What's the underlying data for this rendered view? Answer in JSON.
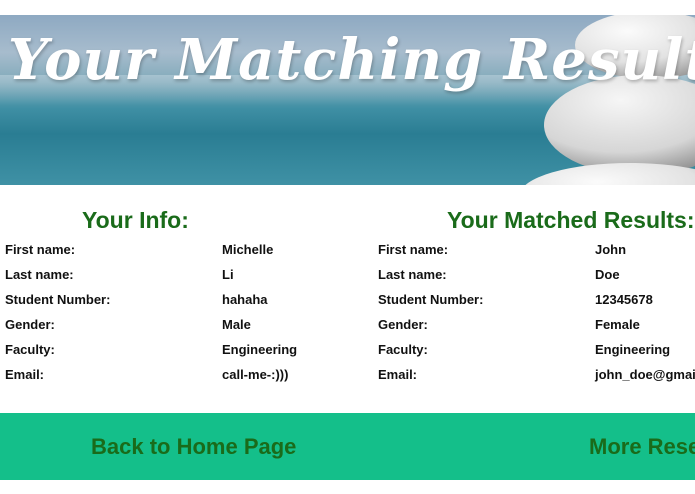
{
  "banner": {
    "title": "Your Matching Results"
  },
  "your_info": {
    "heading": "Your Info:",
    "rows": [
      {
        "label": "First name:",
        "value": "Michelle"
      },
      {
        "label": "Last name:",
        "value": "Li"
      },
      {
        "label": "Student Number:",
        "value": "hahaha"
      },
      {
        "label": "Gender:",
        "value": "Male"
      },
      {
        "label": "Faculty:",
        "value": "Engineering"
      },
      {
        "label": "Email:",
        "value": "call-me-:)))"
      }
    ]
  },
  "matched": {
    "heading": "Your Matched Results:",
    "rows": [
      {
        "label": "First name:",
        "value": "John"
      },
      {
        "label": "Last name:",
        "value": "Doe"
      },
      {
        "label": "Student Number:",
        "value": "12345678"
      },
      {
        "label": "Gender:",
        "value": "Female"
      },
      {
        "label": "Faculty:",
        "value": "Engineering"
      },
      {
        "label": "Email:",
        "value": "john_doe@gmail"
      }
    ]
  },
  "footer": {
    "home_label": "Back to Home Page",
    "more_label": "More Rese"
  },
  "colors": {
    "heading_green": "#1a6b1a",
    "footer_bg": "#14bf8a"
  }
}
